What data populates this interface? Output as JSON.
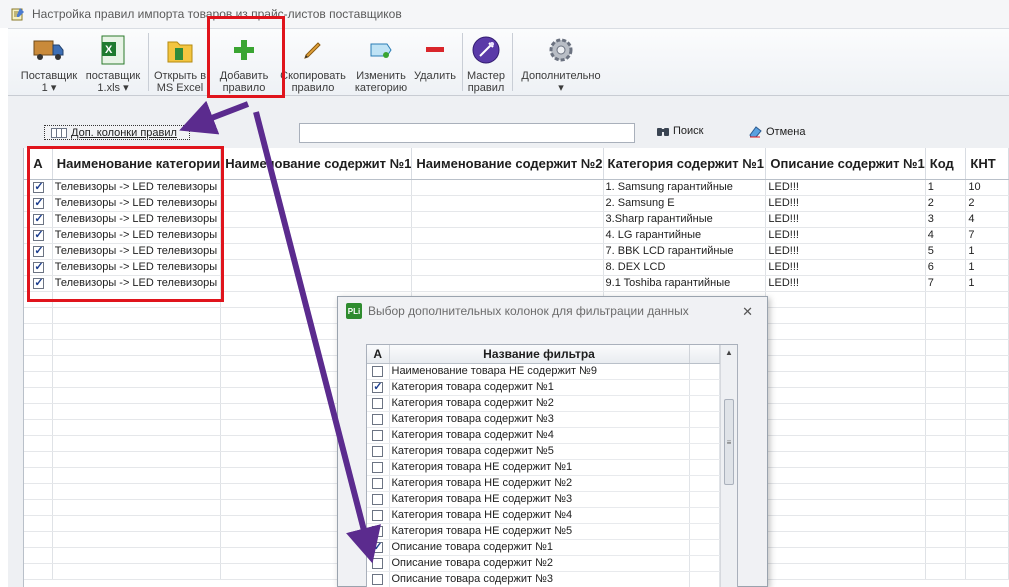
{
  "window": {
    "title": "Настройка правил импорта товаров из прайс-листов поставщиков"
  },
  "ribbon": {
    "buttons": [
      {
        "label": "Поставщик",
        "sub": "1 ▾",
        "icon": "truck-icon"
      },
      {
        "label": "поставщик",
        "sub": "1.xls ▾",
        "icon": "excel-file-icon"
      },
      {
        "label": "Открыть в",
        "sub": "MS Excel",
        "icon": "folder-excel-icon"
      },
      {
        "label": "Добавить",
        "sub": "правило",
        "icon": "plus-icon"
      },
      {
        "label": "Скопировать",
        "sub": "правило",
        "icon": "pencil-icon"
      },
      {
        "label": "Изменить",
        "sub": "категорию",
        "icon": "edit-tag-icon"
      },
      {
        "label": "Удалить",
        "sub": "",
        "icon": "minus-icon"
      },
      {
        "label": "Мастер",
        "sub": "правил",
        "icon": "wizard-icon"
      },
      {
        "label": "Дополнительно",
        "sub": "▾",
        "icon": "gear-icon"
      }
    ]
  },
  "toolbar": {
    "extra_columns_label": "Доп. колонки правил",
    "search_value": "",
    "search_label": "Поиск",
    "cancel_label": "Отмена"
  },
  "grid": {
    "columns": [
      "А",
      "Наименование категории",
      "Наименование содержит №1",
      "Наименование содержит №2",
      "Категория содержит №1",
      "Описание содержит №1",
      "Код",
      "КНТ"
    ],
    "rows": [
      {
        "active": true,
        "category": "Телевизоры -> LED телевизоры",
        "name1": "",
        "name2": "",
        "cat1": "1. Samsung гарантийные",
        "desc1": "LED!!!",
        "code": "1",
        "knt": "10"
      },
      {
        "active": true,
        "category": "Телевизоры -> LED телевизоры",
        "name1": "",
        "name2": "",
        "cat1": "2. Samsung E",
        "desc1": "LED!!!",
        "code": "2",
        "knt": "2"
      },
      {
        "active": true,
        "category": "Телевизоры -> LED телевизоры",
        "name1": "",
        "name2": "",
        "cat1": "3.Sharp гарантийные",
        "desc1": "LED!!!",
        "code": "3",
        "knt": "4"
      },
      {
        "active": true,
        "category": "Телевизоры -> LED телевизоры",
        "name1": "",
        "name2": "",
        "cat1": "4. LG гарантийные",
        "desc1": "LED!!!",
        "code": "4",
        "knt": "7"
      },
      {
        "active": true,
        "category": "Телевизоры -> LED телевизоры",
        "name1": "",
        "name2": "",
        "cat1": "7. BBK LCD гарантийные",
        "desc1": "LED!!!",
        "code": "5",
        "knt": "1"
      },
      {
        "active": true,
        "category": "Телевизоры -> LED телевизоры",
        "name1": "",
        "name2": "",
        "cat1": "8. DEX LCD",
        "desc1": "LED!!!",
        "code": "6",
        "knt": "1"
      },
      {
        "active": true,
        "category": "Телевизоры -> LED телевизоры",
        "name1": "",
        "name2": "",
        "cat1": "9.1 Toshiba гарантийные",
        "desc1": "LED!!!",
        "code": "7",
        "knt": "1"
      }
    ]
  },
  "dialog": {
    "title": "Выбор дополнительных колонок для фильтрации данных",
    "icon_text": "PLi",
    "columns": [
      "А",
      "Название фильтра"
    ],
    "items": [
      {
        "checked": false,
        "label": "Наименование товара НЕ содержит №9"
      },
      {
        "checked": true,
        "label": "Категория товара содержит №1"
      },
      {
        "checked": false,
        "label": "Категория товара содержит №2"
      },
      {
        "checked": false,
        "label": "Категория товара содержит №3"
      },
      {
        "checked": false,
        "label": "Категория товара содержит №4"
      },
      {
        "checked": false,
        "label": "Категория товара содержит №5"
      },
      {
        "checked": false,
        "label": "Категория товара НЕ содержит №1"
      },
      {
        "checked": false,
        "label": "Категория товара НЕ содержит №2"
      },
      {
        "checked": false,
        "label": "Категория товара НЕ содержит №3"
      },
      {
        "checked": false,
        "label": "Категория товара НЕ содержит №4"
      },
      {
        "checked": false,
        "label": "Категория товара НЕ содержит №5"
      },
      {
        "checked": true,
        "label": "Описание товара содержит №1"
      },
      {
        "checked": false,
        "label": "Описание товара содержит №2"
      },
      {
        "checked": false,
        "label": "Описание товара содержит №3"
      }
    ]
  },
  "colors": {
    "highlight": "#e0141c",
    "arrow": "#5b2b8e",
    "checkmark": "#1d3f8f"
  }
}
